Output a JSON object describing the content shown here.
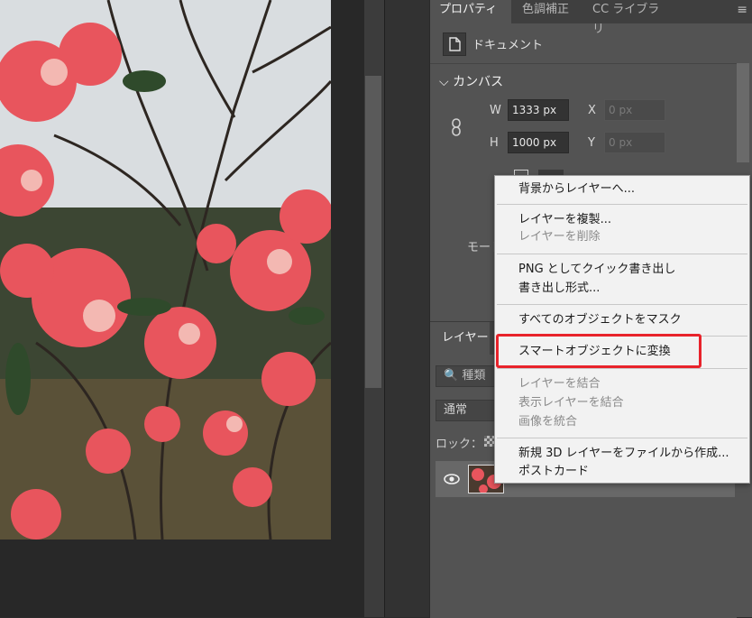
{
  "properties_tabs": [
    {
      "label": "プロパティ",
      "active": true
    },
    {
      "label": "色調補正",
      "active": false
    },
    {
      "label": "CC ライブラリ",
      "active": false
    }
  ],
  "document": {
    "label": "ドキュメント"
  },
  "canvas": {
    "section_title": "カンバス",
    "width_label": "W",
    "width_value": "1333 px",
    "height_label": "H",
    "height_value": "1000 px",
    "x_label": "X",
    "x_placeholder": "0 px",
    "y_label": "Y",
    "y_placeholder": "0 px",
    "mode_label": "モード"
  },
  "layers_panel": {
    "tab_label": "レイヤー",
    "kind_label": "種類",
    "blend_mode": "通常",
    "lock_label": "ロック："
  },
  "context_menu": {
    "items": [
      {
        "label": "背景からレイヤーへ...",
        "disabled": false
      },
      {
        "label": "レイヤーを複製...",
        "disabled": false
      },
      {
        "label": "レイヤーを削除",
        "disabled": true
      },
      {
        "label": "PNG としてクイック書き出し",
        "disabled": false
      },
      {
        "label": "書き出し形式...",
        "disabled": false
      },
      {
        "label": "すべてのオブジェクトをマスク",
        "disabled": false
      },
      {
        "label": "スマートオブジェクトに変換",
        "disabled": false
      },
      {
        "label": "レイヤーを結合",
        "disabled": true
      },
      {
        "label": "表示レイヤーを結合",
        "disabled": true
      },
      {
        "label": "画像を統合",
        "disabled": true
      },
      {
        "label": "新規 3D レイヤーをファイルから作成...",
        "disabled": false
      },
      {
        "label": "ポストカード",
        "disabled": false
      }
    ]
  },
  "colors": {
    "highlight": "#e8232b",
    "panel_bg": "#535353",
    "menu_bg": "#f2f2f2"
  }
}
